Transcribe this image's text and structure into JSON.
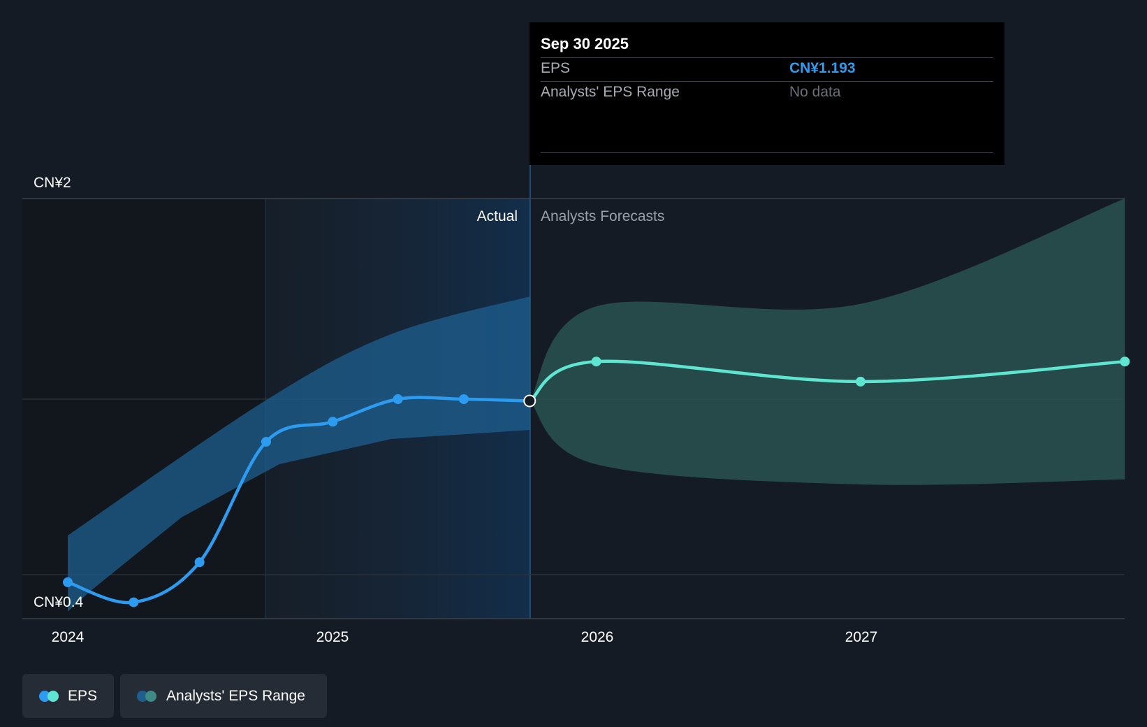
{
  "tooltip": {
    "date": "Sep 30 2025",
    "rows": [
      {
        "label": "EPS",
        "value": "CN¥1.193",
        "value_color": "#2d9cf0"
      },
      {
        "label": "Analysts' EPS Range",
        "value": "No data",
        "value_color": "#6b7077"
      }
    ]
  },
  "legend": [
    {
      "label": "EPS",
      "colors": [
        "#2d9cf0",
        "#5ee6d2"
      ]
    },
    {
      "label": "Analysts' EPS Range",
      "colors": [
        "#1e5f8f",
        "#3e8a84"
      ]
    }
  ],
  "chart_data": {
    "type": "line",
    "y_tick_labels": [
      "CN¥2",
      "CN¥0.4"
    ],
    "ylim": [
      0.4,
      2.0
    ],
    "x_tick_labels": [
      "2024",
      "2025",
      "2026",
      "2027"
    ],
    "section_labels": {
      "actual": "Actual",
      "forecast": "Analysts Forecasts"
    },
    "grid": true,
    "legend_position": "bottom-left",
    "colors": {
      "actual": "#2d9cf0",
      "forecast": "#5ee6d2",
      "actual_band": "#1e5f8f",
      "forecast_band": "#2a5552"
    },
    "series": [
      {
        "name": "EPS",
        "segment": "actual",
        "points": [
          {
            "x": "2024-01-01",
            "y": 0.47
          },
          {
            "x": "2024-04-01",
            "y": 0.39
          },
          {
            "x": "2024-07-01",
            "y": 0.55
          },
          {
            "x": "2024-10-01",
            "y": 1.03
          },
          {
            "x": "2025-01-01",
            "y": 1.11
          },
          {
            "x": "2025-04-01",
            "y": 1.2
          },
          {
            "x": "2025-07-01",
            "y": 1.2
          },
          {
            "x": "2025-09-30",
            "y": 1.193
          }
        ]
      },
      {
        "name": "EPS",
        "segment": "forecast",
        "points": [
          {
            "x": "2025-09-30",
            "y": 1.193
          },
          {
            "x": "2025-12-31",
            "y": 1.35
          },
          {
            "x": "2026-12-31",
            "y": 1.27
          },
          {
            "x": "2027-12-31",
            "y": 1.35
          }
        ]
      }
    ],
    "ranges": [
      {
        "name": "Analysts' EPS Range",
        "segment": "forecast",
        "x": [
          "2025-09-30",
          "2025-12-31",
          "2026-12-31",
          "2027-12-31"
        ],
        "low": [
          1.193,
          0.94,
          0.86,
          0.88
        ],
        "high": [
          1.193,
          1.57,
          1.58,
          2.0
        ]
      }
    ]
  }
}
